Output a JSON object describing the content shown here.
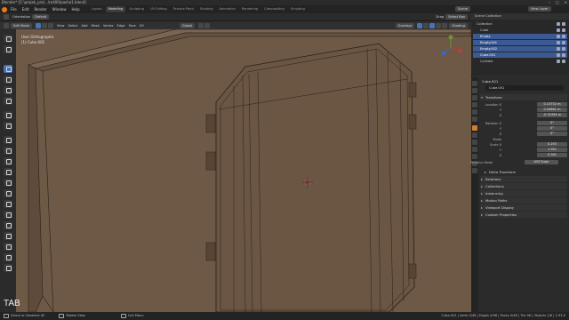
{
  "titlebar": {
    "title": "Blender* [C:\\projek_pro\\...\\m400\\pasha1.blend]"
  },
  "menubar": {
    "items": [
      "File",
      "Edit",
      "Render",
      "Window",
      "Help"
    ],
    "workspaces": [
      "Layout",
      "Modeling",
      "Sculpting",
      "UV Editing",
      "Texture Paint",
      "Shading",
      "Animation",
      "Rendering",
      "Compositing",
      "Scripting"
    ],
    "active_workspace": "Modeling",
    "scene": "Scene",
    "view_layer": "View Layer"
  },
  "tool_settings": {
    "orientation_label": "Orientation",
    "orientation_value": "Default",
    "drag_label": "Drag",
    "drag_value": "Select Box"
  },
  "viewport_header": {
    "mode": "Edit Mode",
    "menus": [
      "View",
      "Select",
      "Add",
      "Mesh",
      "Vertex",
      "Edge",
      "Face",
      "UV"
    ],
    "transform": "Global",
    "overlays": "Overlays",
    "shading": "Shading"
  },
  "viewport": {
    "view_name": "User Orthographic",
    "object_name": "(1) Cube.001",
    "key_hint": "TAB",
    "background_color": "#6e5846",
    "wire_color": "#2a2118"
  },
  "outliner": {
    "header": "Scene Collection",
    "rows": [
      {
        "label": "Collection",
        "selected": false
      },
      {
        "label": "Cube",
        "selected": false
      },
      {
        "label": "Empty",
        "selected": true
      },
      {
        "label": "Empty.001",
        "selected": true
      },
      {
        "label": "Empty.002",
        "selected": true
      },
      {
        "label": "Cube.001",
        "selected": true
      },
      {
        "label": "Cylinder",
        "selected": false
      }
    ]
  },
  "properties": {
    "object_name": "Cube.001",
    "object_field": "Cube.001",
    "transform_section": "Transform",
    "location_label": "Location X",
    "location": [
      "0.13752 m",
      "0.04881 m",
      "-0.31394 m"
    ],
    "rotation_label": "Rotation X",
    "rotation": [
      "0°",
      "0°",
      "0°"
    ],
    "mode_label": "Mode",
    "scale_label": "Scale X",
    "scale": [
      "0.253",
      "1.351",
      "0.341"
    ],
    "relation_label": "Relative Mode",
    "relation_value": "XYZ Euler",
    "sections": [
      "Delta Transform",
      "Relations",
      "Collections",
      "Instancing",
      "Motion Paths",
      "Viewport Display",
      "Custom Properties"
    ],
    "axis_y": "Y",
    "axis_z": "Z",
    "axis_w": "W"
  },
  "statusbar": {
    "left_items": [
      "Select or Deselect All",
      "Rotate View",
      "Call Menu"
    ],
    "stats": "Cube.001 | Verts 0/48 | Edges 0/96 | Faces 0/48 | Tris 96 | Objects 1/6 | 2.93.0"
  }
}
